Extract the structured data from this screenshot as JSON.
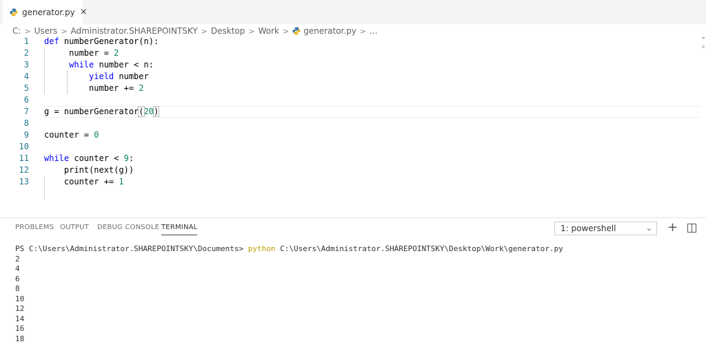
{
  "tab": {
    "name": "generator.py",
    "close": "×"
  },
  "breadcrumb": [
    "C:",
    "Users",
    "Administrator.SHAREPOINTSKY",
    "Desktop",
    "Work",
    "generator.py",
    "..."
  ],
  "editor": {
    "line_numbers": [
      "1",
      "2",
      "3",
      "4",
      "5",
      "6",
      "7",
      "8",
      "9",
      "10",
      "11",
      "12",
      "13"
    ]
  },
  "panel": {
    "tabs": [
      "PROBLEMS",
      "OUTPUT",
      "DEBUG CONSOLE",
      "TERMINAL"
    ],
    "active_tab": "TERMINAL",
    "terminal_select": "1: powershell",
    "prompt": "PS C:\\Users\\Administrator.SHAREPOINTSKY\\Documents> ",
    "command": "python",
    "args": " C:\\Users\\Administrator.SHAREPOINTSKY\\Desktop\\Work\\generator.py",
    "output": [
      "2",
      "4",
      "6",
      "8",
      "10",
      "12",
      "14",
      "16",
      "18"
    ]
  },
  "colors": {
    "keyword": "#0000ff",
    "number": "#098658",
    "line_number": "#237893",
    "python_cmd": "#b8a000"
  }
}
